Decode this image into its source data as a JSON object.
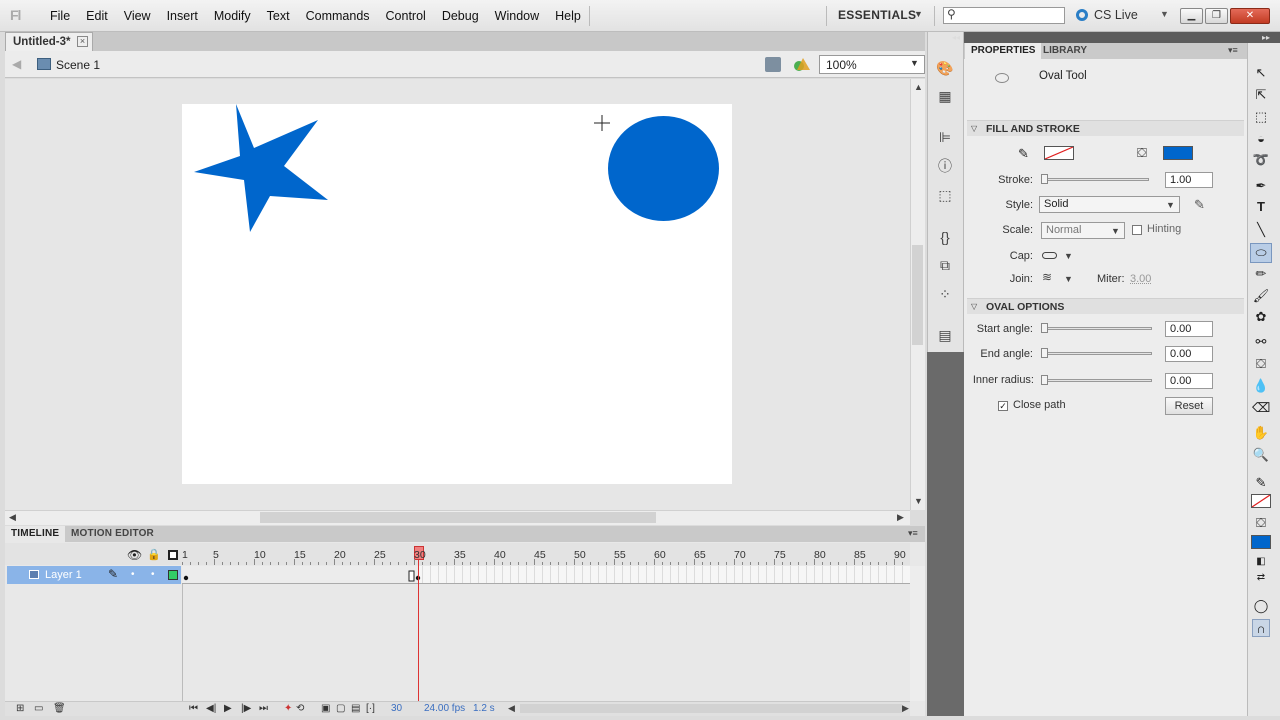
{
  "app": {
    "logo": "Fl"
  },
  "menu": [
    "File",
    "Edit",
    "View",
    "Insert",
    "Modify",
    "Text",
    "Commands",
    "Control",
    "Debug",
    "Window",
    "Help"
  ],
  "workspace": {
    "label": "ESSENTIALS",
    "cslive": "CS Live"
  },
  "document": {
    "tab": "Untitled-3*",
    "scene": "Scene 1",
    "zoom": "100%"
  },
  "shapes": {
    "color": "#0066cc"
  },
  "timeline": {
    "tabs": [
      "TIMELINE",
      "MOTION EDITOR"
    ],
    "frame_numbers": [
      "1",
      "5",
      "10",
      "15",
      "20",
      "25",
      "30",
      "35",
      "40",
      "45",
      "50",
      "55",
      "60",
      "65",
      "70",
      "75",
      "80",
      "85",
      "90"
    ],
    "layer": {
      "name": "Layer 1"
    },
    "current_frame": "30",
    "fps": "24.00 fps",
    "time": "1.2 s"
  },
  "properties": {
    "tabs": {
      "properties": "PROPERTIES",
      "library": "LIBRARY"
    },
    "tool_name": "Oval Tool",
    "fill_stroke": {
      "header": "FILL AND STROKE",
      "stroke_label": "Stroke:",
      "stroke_value": "1.00",
      "style_label": "Style:",
      "style_value": "Solid",
      "scale_label": "Scale:",
      "scale_value": "Normal",
      "hinting_label": "Hinting",
      "cap_label": "Cap:",
      "join_label": "Join:",
      "miter_label": "Miter:",
      "miter_value": "3.00",
      "fill_color": "#0066cc"
    },
    "oval_options": {
      "header": "OVAL OPTIONS",
      "start_label": "Start angle:",
      "start_value": "0.00",
      "end_label": "End angle:",
      "end_value": "0.00",
      "inner_label": "Inner radius:",
      "inner_value": "0.00",
      "close_path_label": "Close path",
      "reset_label": "Reset"
    }
  }
}
